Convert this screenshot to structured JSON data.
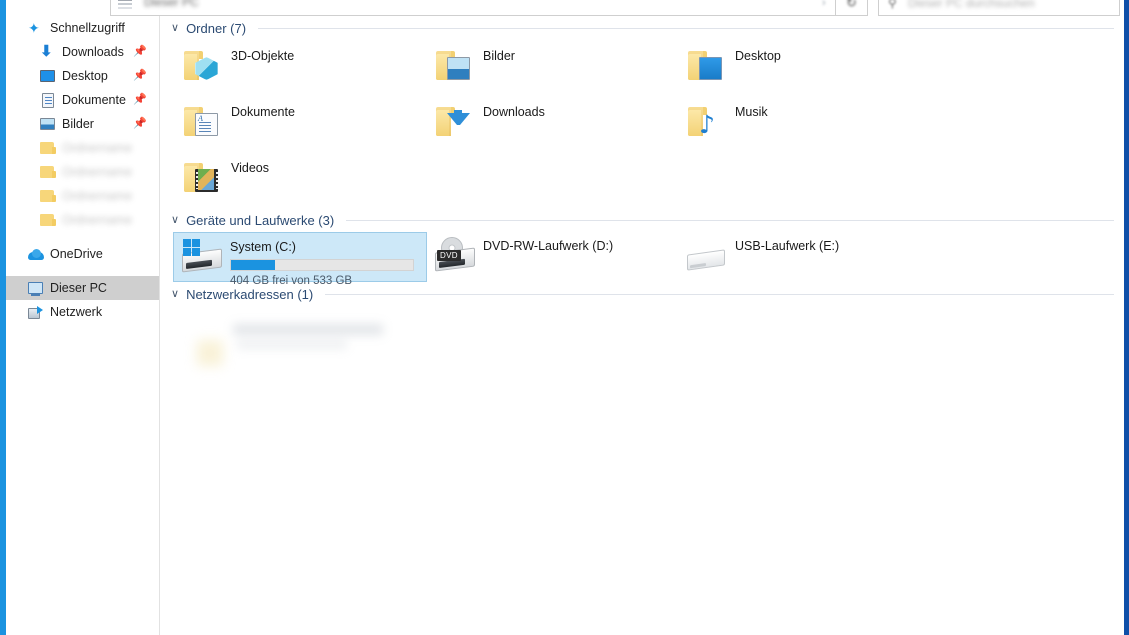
{
  "window": {
    "accent_left": "#1b93e0",
    "accent_right": "#0f4fa8"
  },
  "addressbar": {
    "path_text": "Dieser PC",
    "chevron": "›",
    "refresh_icon": "↻",
    "search_icon": "⚲"
  },
  "search": {
    "placeholder": "Dieser PC durchsuchen"
  },
  "sidebar": {
    "items": [
      {
        "label": "Schnellzugriff",
        "icon": "star-icon",
        "pinned": false,
        "child": false,
        "selected": false,
        "blurred": false
      },
      {
        "label": "Downloads",
        "icon": "download-arrow-icon",
        "pinned": true,
        "child": true,
        "selected": false,
        "blurred": false
      },
      {
        "label": "Desktop",
        "icon": "monitor-icon",
        "pinned": true,
        "child": true,
        "selected": false,
        "blurred": false
      },
      {
        "label": "Dokumente",
        "icon": "document-icon",
        "pinned": true,
        "child": true,
        "selected": false,
        "blurred": false
      },
      {
        "label": "Bilder",
        "icon": "picture-icon",
        "pinned": true,
        "child": true,
        "selected": false,
        "blurred": false
      },
      {
        "label": "",
        "icon": "folder-icon",
        "pinned": false,
        "child": true,
        "selected": false,
        "blurred": true
      },
      {
        "label": "",
        "icon": "folder-icon",
        "pinned": false,
        "child": true,
        "selected": false,
        "blurred": true
      },
      {
        "label": "",
        "icon": "folder-icon",
        "pinned": false,
        "child": true,
        "selected": false,
        "blurred": true
      },
      {
        "label": "",
        "icon": "folder-icon",
        "pinned": false,
        "child": true,
        "selected": false,
        "blurred": true
      },
      {
        "label": "OneDrive",
        "icon": "cloud-icon",
        "pinned": false,
        "child": false,
        "selected": false,
        "blurred": false
      },
      {
        "label": "Dieser PC",
        "icon": "this-pc-icon",
        "pinned": false,
        "child": false,
        "selected": true,
        "blurred": false
      },
      {
        "label": "Netzwerk",
        "icon": "network-icon",
        "pinned": false,
        "child": false,
        "selected": false,
        "blurred": false
      }
    ],
    "pin_glyph": "📌"
  },
  "content": {
    "groups": [
      {
        "id": "folders",
        "title": "Ordner (7)",
        "chevron": "∨",
        "items": [
          {
            "label": "3D-Objekte",
            "emblem": "cube-emblem"
          },
          {
            "label": "Bilder",
            "emblem": "picture-emblem"
          },
          {
            "label": "Desktop",
            "emblem": "desktop-emblem"
          },
          {
            "label": "Dokumente",
            "emblem": "document-emblem"
          },
          {
            "label": "Downloads",
            "emblem": "download-emblem"
          },
          {
            "label": "Musik",
            "emblem": "music-emblem"
          },
          {
            "label": "Videos",
            "emblem": "video-emblem"
          }
        ]
      },
      {
        "id": "drives",
        "title": "Geräte und Laufwerke (3)",
        "chevron": "∨",
        "items": [
          {
            "label": "System (C:)",
            "icon": "hard-disk-icon",
            "selected": true,
            "has_bar": true,
            "free_text": "404 GB frei von 533 GB",
            "free_gb": 404,
            "total_gb": 533,
            "used_percent": 24,
            "bar_color": "#1b93e0"
          },
          {
            "label": "DVD-RW-Laufwerk (D:)",
            "icon": "dvd-drive-icon",
            "selected": false,
            "has_bar": false,
            "badge": "DVD"
          },
          {
            "label": "USB-Laufwerk (E:)",
            "icon": "usb-drive-icon",
            "selected": false,
            "has_bar": false
          }
        ]
      },
      {
        "id": "network",
        "title": "Netzwerkadressen (1)",
        "chevron": "∨",
        "items": []
      }
    ]
  }
}
